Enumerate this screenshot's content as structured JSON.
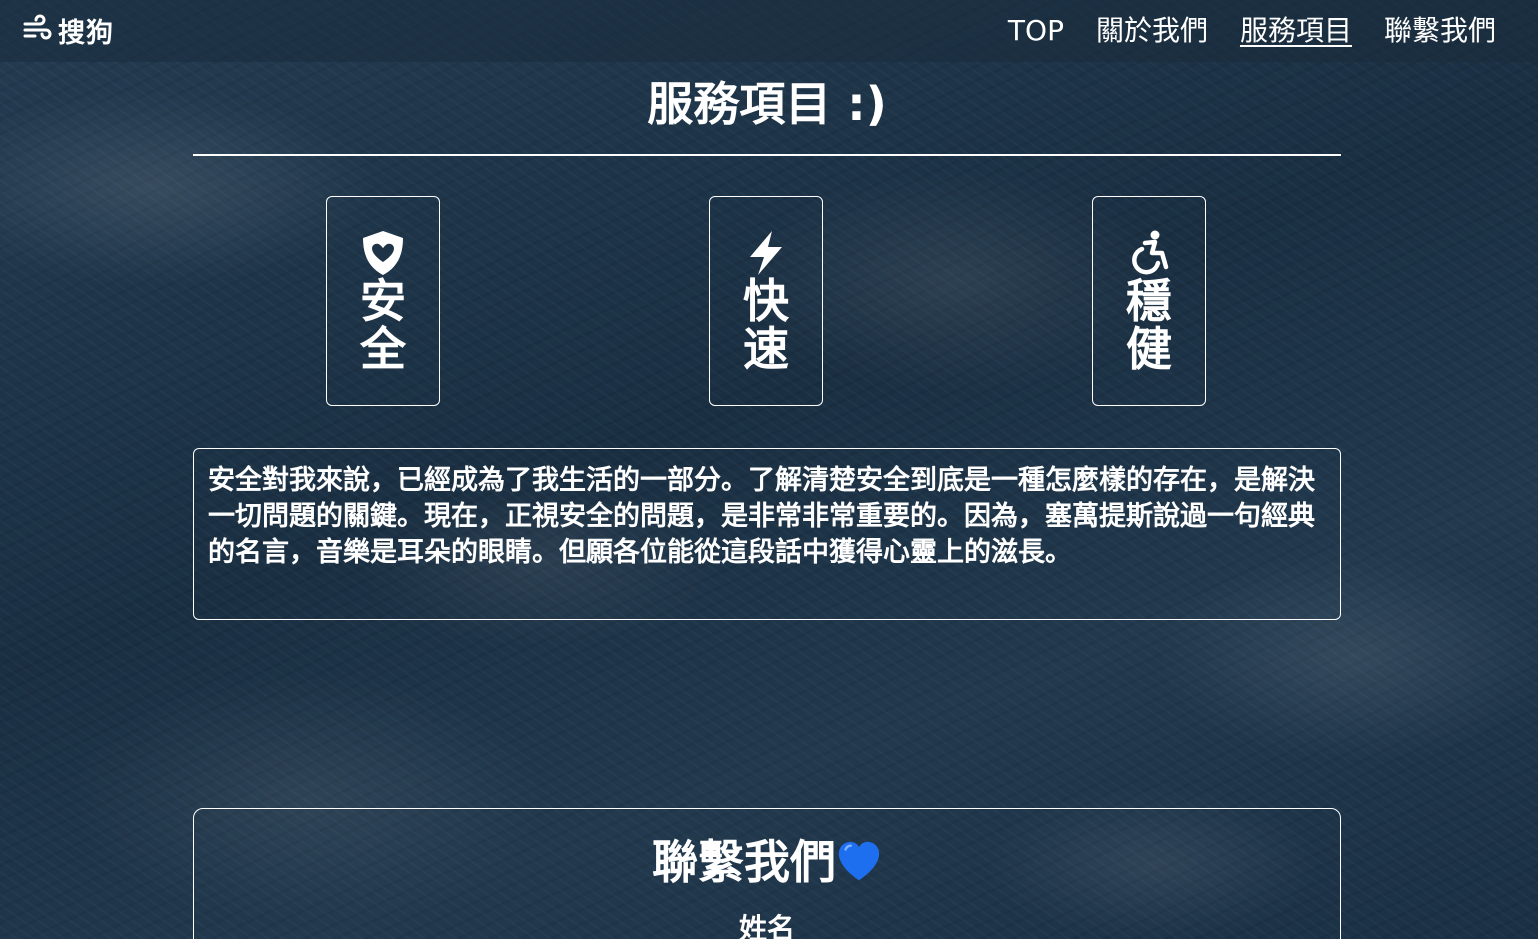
{
  "nav": {
    "brand_icon": "wind-icon",
    "brand": "搜狗",
    "links": [
      "TOP",
      "關於我們",
      "服務項目",
      "聯繫我們"
    ],
    "active": "服務項目"
  },
  "services": {
    "title": "服務項目 :)",
    "cards": [
      {
        "icon": "shield-heart-icon",
        "label": "安全"
      },
      {
        "icon": "lightning-bolt-icon",
        "label": "快速"
      },
      {
        "icon": "wheelchair-icon",
        "label": "穩健"
      }
    ],
    "description": "安全對我來說，已經成為了我生活的一部分。了解清楚安全到底是一種怎麼樣的存在，是解決一切問題的關鍵。現在，正視安全的問題，是非常非常重要的。因為，塞萬提斯說過一句經典的名言，音樂是耳朵的眼睛。但願各位能從這段話中獲得心靈上的滋長。"
  },
  "contact": {
    "title": "聯繫我們",
    "title_icon": "blue-heart-icon",
    "name_label": "姓名"
  },
  "colors": {
    "text": "#ffffff",
    "heart": "#1e6ff0",
    "background": "#1e3346"
  }
}
